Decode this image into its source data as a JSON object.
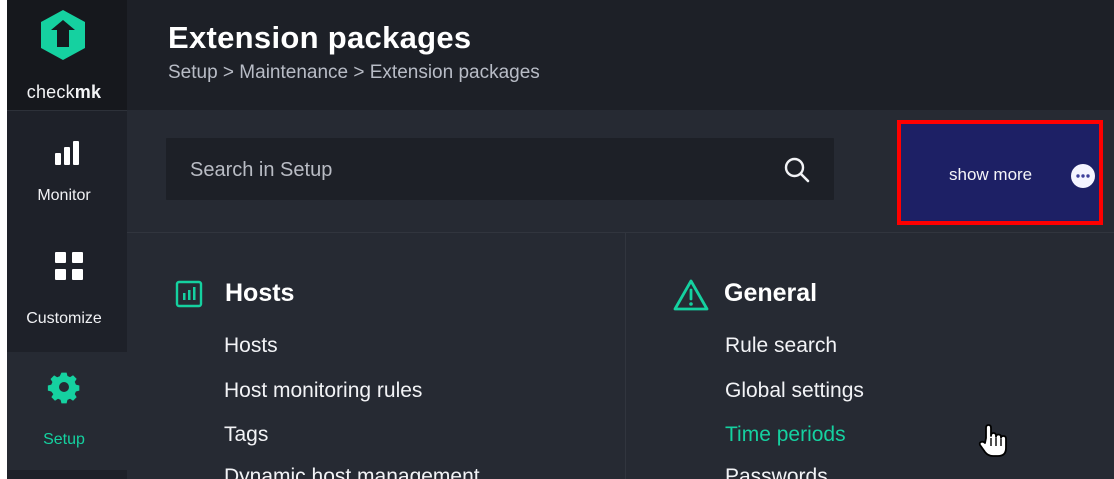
{
  "brand": {
    "name_prefix": "check",
    "name_suffix": "mk",
    "logo_icon": "checkmk-logo-icon"
  },
  "sidebar": {
    "items": [
      {
        "label": "Monitor",
        "icon": "bar-chart-icon",
        "active": false
      },
      {
        "label": "Customize",
        "icon": "grid-icon",
        "active": false
      },
      {
        "label": "Setup",
        "icon": "gear-icon",
        "active": true
      }
    ]
  },
  "header": {
    "title": "Extension packages",
    "breadcrumb": "Setup > Maintenance > Extension packages"
  },
  "toolbar": {
    "search_placeholder": "Search in Setup",
    "search_icon": "search-icon",
    "show_more_label": "show more",
    "show_more_icon": "more-circle-icon"
  },
  "menu": {
    "groups": [
      {
        "title": "Hosts",
        "icon": "hosts-icon",
        "items": [
          {
            "label": "Hosts",
            "active": false
          },
          {
            "label": "Host monitoring rules",
            "active": false
          },
          {
            "label": "Tags",
            "active": false
          },
          {
            "label": "Dynamic host management",
            "active": false
          }
        ]
      },
      {
        "title": "General",
        "icon": "warning-icon",
        "items": [
          {
            "label": "Rule search",
            "active": false
          },
          {
            "label": "Global settings",
            "active": false
          },
          {
            "label": "Time periods",
            "active": true
          },
          {
            "label": "Passwords",
            "active": false
          }
        ]
      }
    ]
  },
  "colors": {
    "accent": "#15d1a0",
    "background": "#262a33",
    "header_background": "#1d2027",
    "sidebar_background": "#1e2129",
    "show_more_background": "#1d2065",
    "highlight_border": "#ff0000"
  },
  "cursor": {
    "icon": "hand-pointer-icon"
  }
}
